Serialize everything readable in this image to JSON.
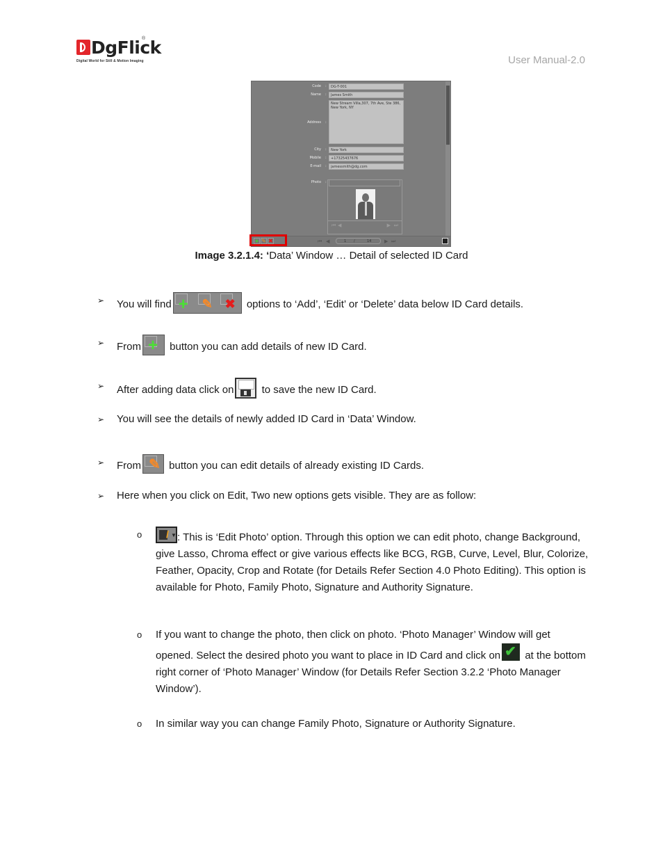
{
  "header": {
    "logo_text": "DgFlick",
    "logo_reg": "®",
    "logo_tagline": "Digital World for Still & Motion Imaging",
    "doc_label": "User Manual-2.0"
  },
  "screenshot": {
    "fields": [
      {
        "label": "Code",
        "value": "DG-T-001"
      },
      {
        "label": "Name",
        "value": "James Smith"
      },
      {
        "label": "Address",
        "value": "New Stream Villa,307, 7th Ave, Ste 386, New York, NY"
      },
      {
        "label": "City",
        "value": "New York"
      },
      {
        "label": "Mobile",
        "value": "+17325437676"
      },
      {
        "label": "E-mail",
        "value": "jamessmith@dg.com"
      },
      {
        "label": "Photo",
        "value": ""
      }
    ],
    "colon": ":",
    "pager": {
      "current": "1",
      "separator": "/",
      "total": "14"
    },
    "toolbar": {
      "add_icon": "add-icon",
      "edit_icon": "edit-icon",
      "delete_icon": "delete-icon",
      "save_icon": "save-icon"
    },
    "highlight_color": "#e00000"
  },
  "caption": {
    "bold": "Image 3.2.1.4: ‘",
    "text": "Data’ Window … Detail of selected ID Card"
  },
  "bullets": [
    {
      "before": "You will find",
      "icon": "add-edit-delete-icons",
      "after": "options to ‘Add’, ‘Edit’ or ‘Delete’ data below ID Card details."
    },
    {
      "before": "From",
      "icon": "add-icon",
      "after": "button you can add details of new ID Card."
    },
    {
      "before": "After adding data click on",
      "icon": "save-icon",
      "after": "to save the new ID Card."
    },
    {
      "text": "You will see the details of newly added ID Card in ‘Data’ Window."
    },
    {
      "before": "From",
      "icon": "edit-icon",
      "after": "button you can edit details of already existing ID Cards."
    },
    {
      "text": "Here when you click on Edit, Two new options gets visible. They are as follow:"
    }
  ],
  "sub_bullets": [
    {
      "icon": "edit-photo-icon",
      "text": ": This is ‘Edit Photo’ option. Through this option we can edit photo, change Background, give Lasso, Chroma effect or give various effects like BCG, RGB, Curve, Level, Blur, Colorize, Feather, Opacity, Crop and Rotate (for Details Refer Section 4.0 Photo Editing). This option is available for Photo, Family Photo, Signature and Authority Signature."
    },
    {
      "before": "If you want to change the photo, then click on photo. ‘Photo Manager’ Window will get opened. Select the desired photo you want to place in ID Card and click on",
      "icon": "checkmark-icon",
      "after": "at the bottom right corner of ‘Photo Manager’ Window (for Details Refer Section 3.2.2 ‘Photo Manager Window’)."
    },
    {
      "text": "In similar way you can change Family Photo, Signature or Authority Signature."
    }
  ],
  "glyphs": {
    "arrow_bullet": "➢",
    "circle_bullet": "o"
  }
}
